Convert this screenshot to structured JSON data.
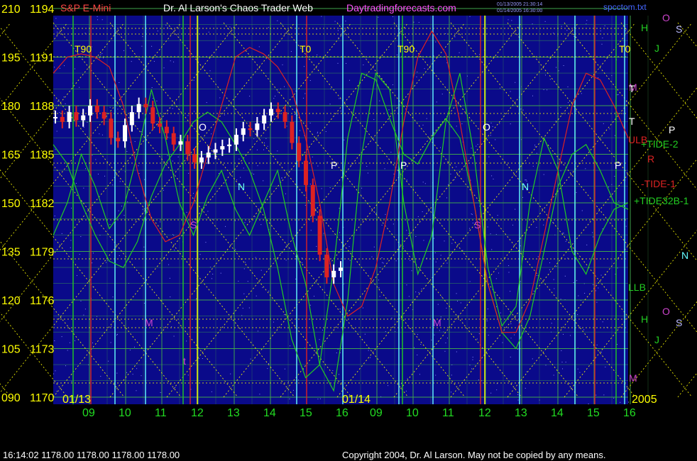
{
  "header": {
    "symbol": "S&P E-Mini",
    "title": "Dr. Al Larson's Chaos Trader Web",
    "site": "Daytradingforecasts.com",
    "stamp1": "01/13/2005 21:30:14",
    "stamp2": "01/14/2005 16:30:00",
    "file": "spcctom.txt"
  },
  "footer": {
    "quote": "16:14:02  1178.00 1178.00 1178.00 1178.00",
    "copyright": "Copyright 2004, Dr. Al Larson. May not be copied by any means."
  },
  "colors": {
    "background": "#000000",
    "plot": "#0a0a8a",
    "grid": "#3fa34d",
    "yellow": "#ffff00",
    "green": "#22cc22",
    "red": "#dd2222",
    "cyan": "#66ffff",
    "magenta": "#cc44cc",
    "white": "#ffffff"
  },
  "chart_data": {
    "type": "line",
    "title": "S&P E-Mini",
    "y_left_labels": [
      "210",
      "195",
      "180",
      "165",
      "150",
      "135",
      "120",
      "105",
      "090"
    ],
    "y_price_labels": [
      "1194",
      "1191",
      "1188",
      "1185",
      "1182",
      "1179",
      "1176",
      "1173",
      "1170"
    ],
    "price_range": [
      1170,
      1194
    ],
    "osc_range": [
      90,
      210
    ],
    "x_ticks": [
      "09",
      "10",
      "11",
      "12",
      "13",
      "14",
      "15",
      "16",
      "09",
      "10",
      "11",
      "12",
      "13",
      "14",
      "15",
      "16"
    ],
    "dates": [
      "01/13",
      "01/14"
    ],
    "year": "2005",
    "legend_right": [
      "ULB",
      "+TIDE-2",
      "-TIDE-1",
      "+TIDE32B-1",
      "LLB"
    ],
    "markers": [
      "T90",
      "T0",
      "T90",
      "T0",
      "O",
      "O",
      "P",
      "P",
      "P",
      "P",
      "N",
      "N",
      "N",
      "S",
      "S",
      "M",
      "M",
      "M",
      "M",
      "t",
      "T",
      "T",
      "R",
      "H",
      "H",
      "J",
      "J",
      "O",
      "O",
      "S",
      "S"
    ],
    "price_close": [
      1187.3,
      1187.0,
      1187.6,
      1187.1,
      1187.4,
      1188.0,
      1187.6,
      1187.2,
      1186.0,
      1185.8,
      1186.8,
      1187.6,
      1188.1,
      1187.9,
      1186.9,
      1186.7,
      1186.3,
      1185.6,
      1185.8,
      1185.0,
      1184.5,
      1184.8,
      1185.1,
      1185.3,
      1185.5,
      1185.6,
      1186.2,
      1186.6,
      1186.5,
      1186.9,
      1187.4,
      1187.8,
      1187.6,
      1187.0,
      1185.7,
      1184.6,
      1183.1,
      1181.2,
      1178.8,
      1177.4,
      1177.8,
      1178.0
    ],
    "series": [
      {
        "name": "+TIDE-2",
        "color": "#22cc22",
        "values": [
          168,
          162,
          150,
          140,
          132,
          130,
          138,
          152,
          162,
          168,
          175,
          178,
          175,
          168,
          160,
          148,
          130,
          108,
          96,
          100,
          130,
          170,
          190,
          188,
          176,
          165,
          162,
          170,
          176,
          170,
          150,
          125,
          110,
          105,
          115,
          135,
          155,
          165,
          168,
          160,
          150,
          148
        ]
      },
      {
        "name": "-TIDE-1",
        "color": "#dd2222",
        "values": [
          190,
          195,
          196,
          195,
          192,
          180,
          160,
          145,
          138,
          140,
          150,
          165,
          180,
          195,
          198,
          196,
          192,
          185,
          170,
          150,
          125,
          115,
          118,
          130,
          150,
          175,
          195,
          203,
          196,
          175,
          150,
          125,
          110,
          110,
          120,
          140,
          160,
          180,
          190,
          188,
          180,
          170
        ]
      },
      {
        "name": "+TIDE32B-1",
        "color": "#22cc22",
        "values": [
          140,
          150,
          165,
          155,
          142,
          148,
          165,
          185,
          170,
          150,
          140,
          152,
          160,
          148,
          140,
          150,
          160,
          140,
          125,
          100,
          92,
          120,
          165,
          190,
          185,
          150,
          128,
          140,
          175,
          190,
          165,
          130,
          112,
          118,
          150,
          170,
          160,
          135,
          128,
          140,
          148,
          150
        ]
      }
    ],
    "grid": true
  }
}
